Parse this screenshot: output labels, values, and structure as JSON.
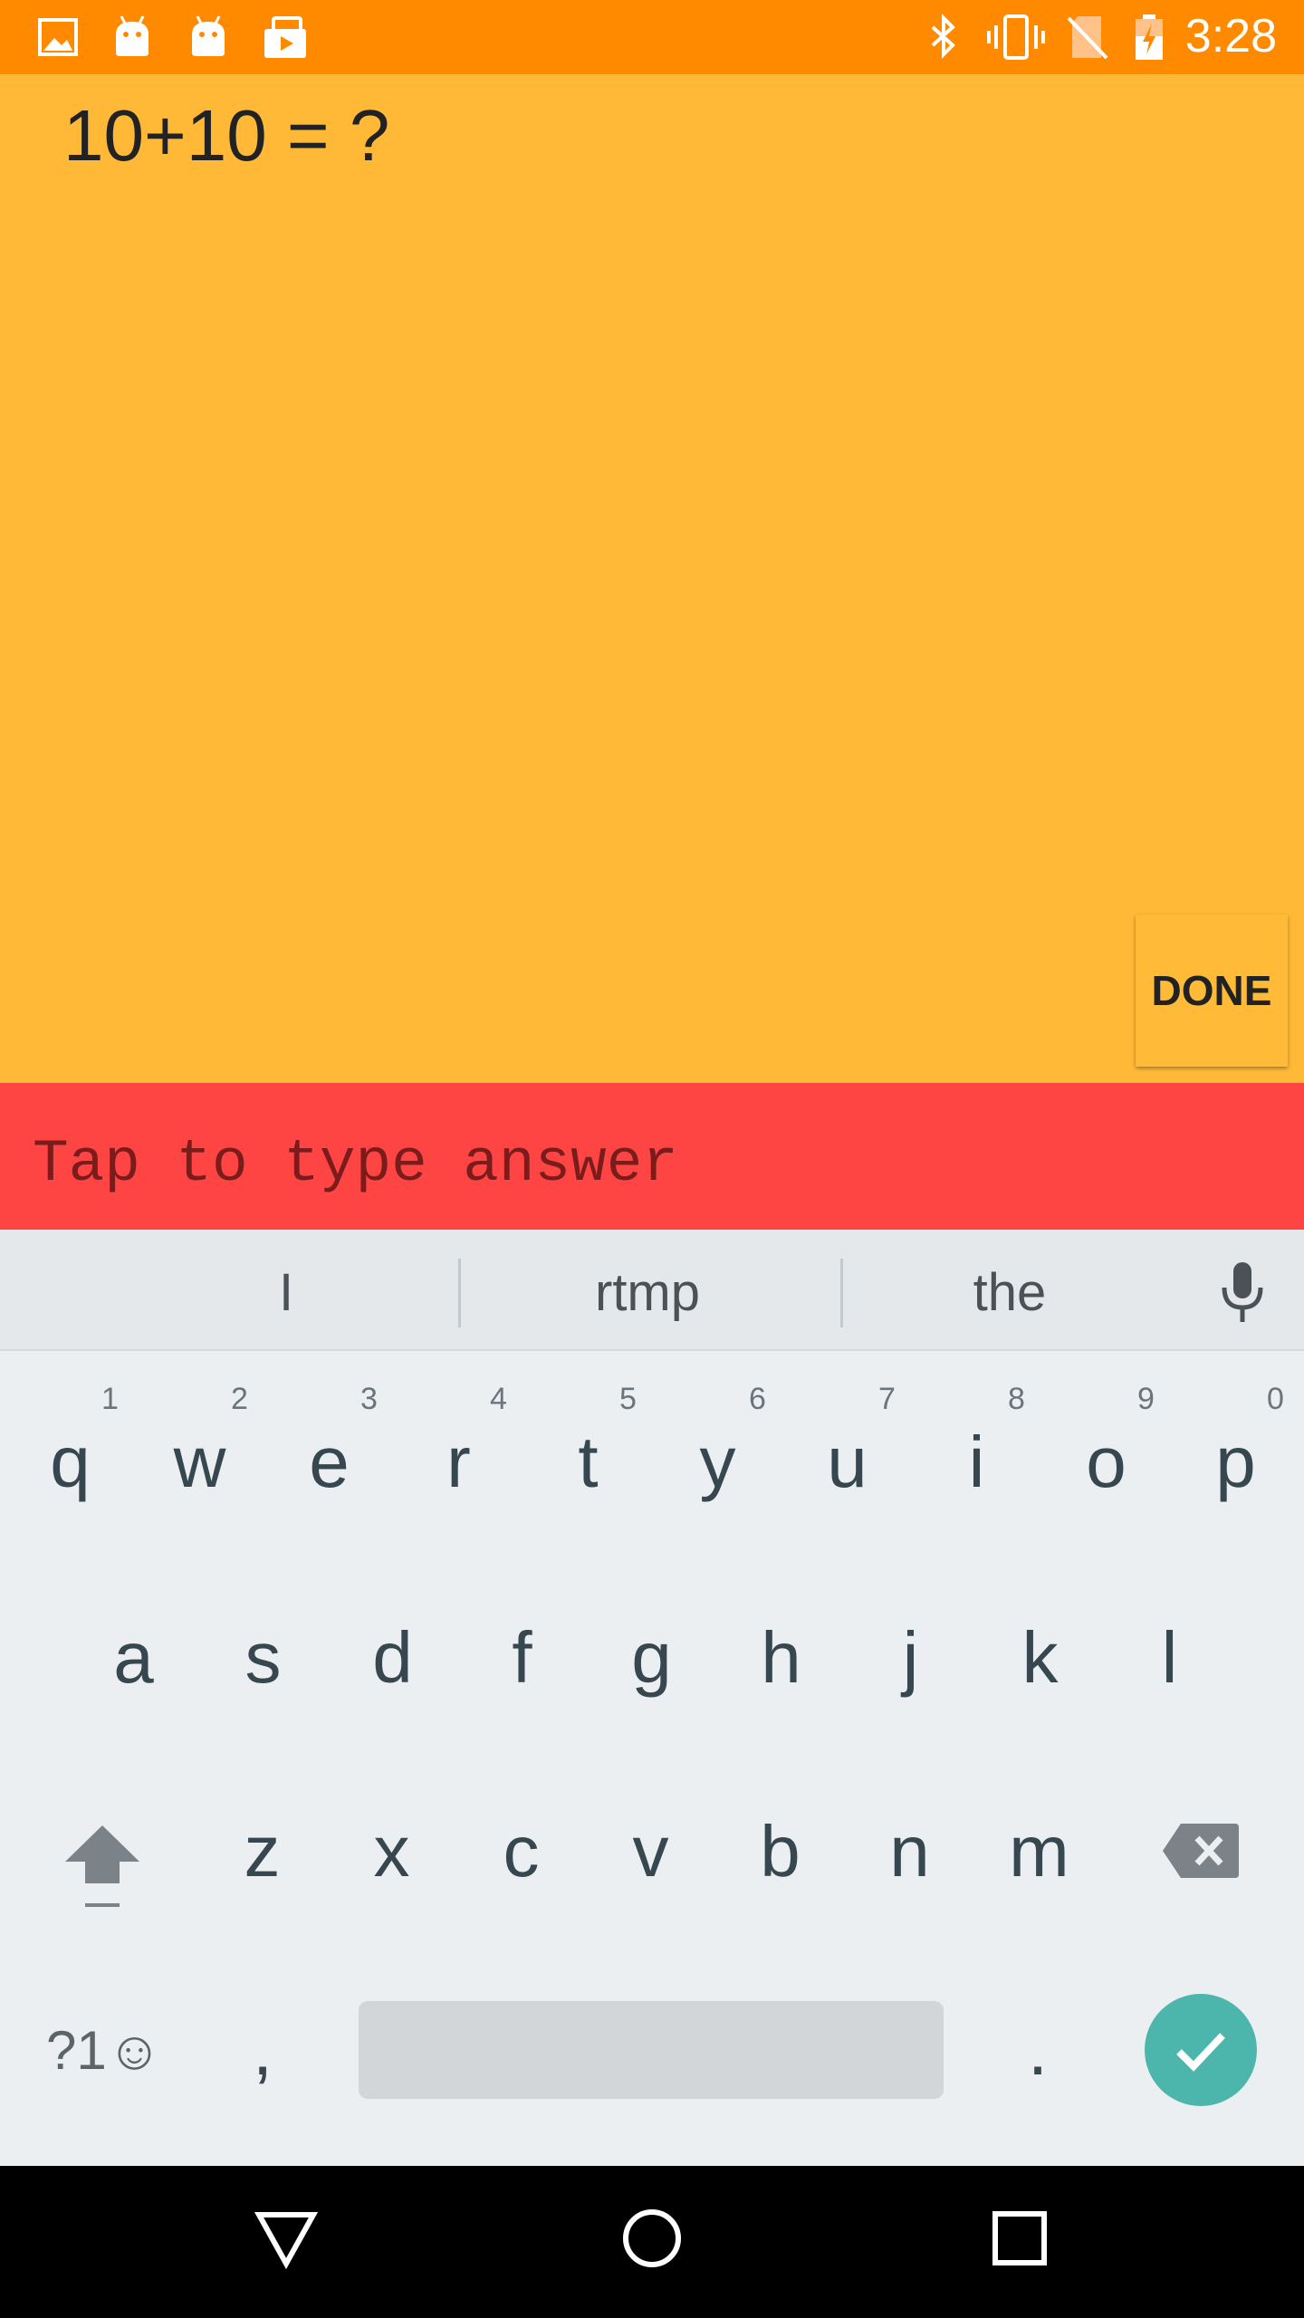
{
  "status_bar": {
    "time": "3:28",
    "left_icons": [
      "image-icon",
      "android-icon",
      "android-icon",
      "briefcase-icon"
    ],
    "right_icons": [
      "bluetooth-icon",
      "vibrate-icon",
      "no-sim-icon",
      "battery-charging-icon"
    ],
    "color": "#FF8A00"
  },
  "main": {
    "question": "10+10 = ?",
    "done_label": "DONE",
    "background": "#FFB937"
  },
  "answer": {
    "placeholder": "Tap to type answer",
    "background": "#FF4444"
  },
  "keyboard": {
    "suggestions": [
      "I",
      "rtmp",
      "the"
    ],
    "row1": [
      "q",
      "w",
      "e",
      "r",
      "t",
      "y",
      "u",
      "i",
      "o",
      "p"
    ],
    "row1_hints": [
      "1",
      "2",
      "3",
      "4",
      "5",
      "6",
      "7",
      "8",
      "9",
      "0"
    ],
    "row2": [
      "a",
      "s",
      "d",
      "f",
      "g",
      "h",
      "j",
      "k",
      "l"
    ],
    "row3": [
      "z",
      "x",
      "c",
      "v",
      "b",
      "n",
      "m"
    ],
    "symbols_label": "?1☺",
    "comma": ",",
    "period": ".",
    "accent": "#4DB6AC"
  },
  "nav_bar": {
    "icons": [
      "back-icon",
      "home-icon",
      "recents-icon"
    ]
  }
}
